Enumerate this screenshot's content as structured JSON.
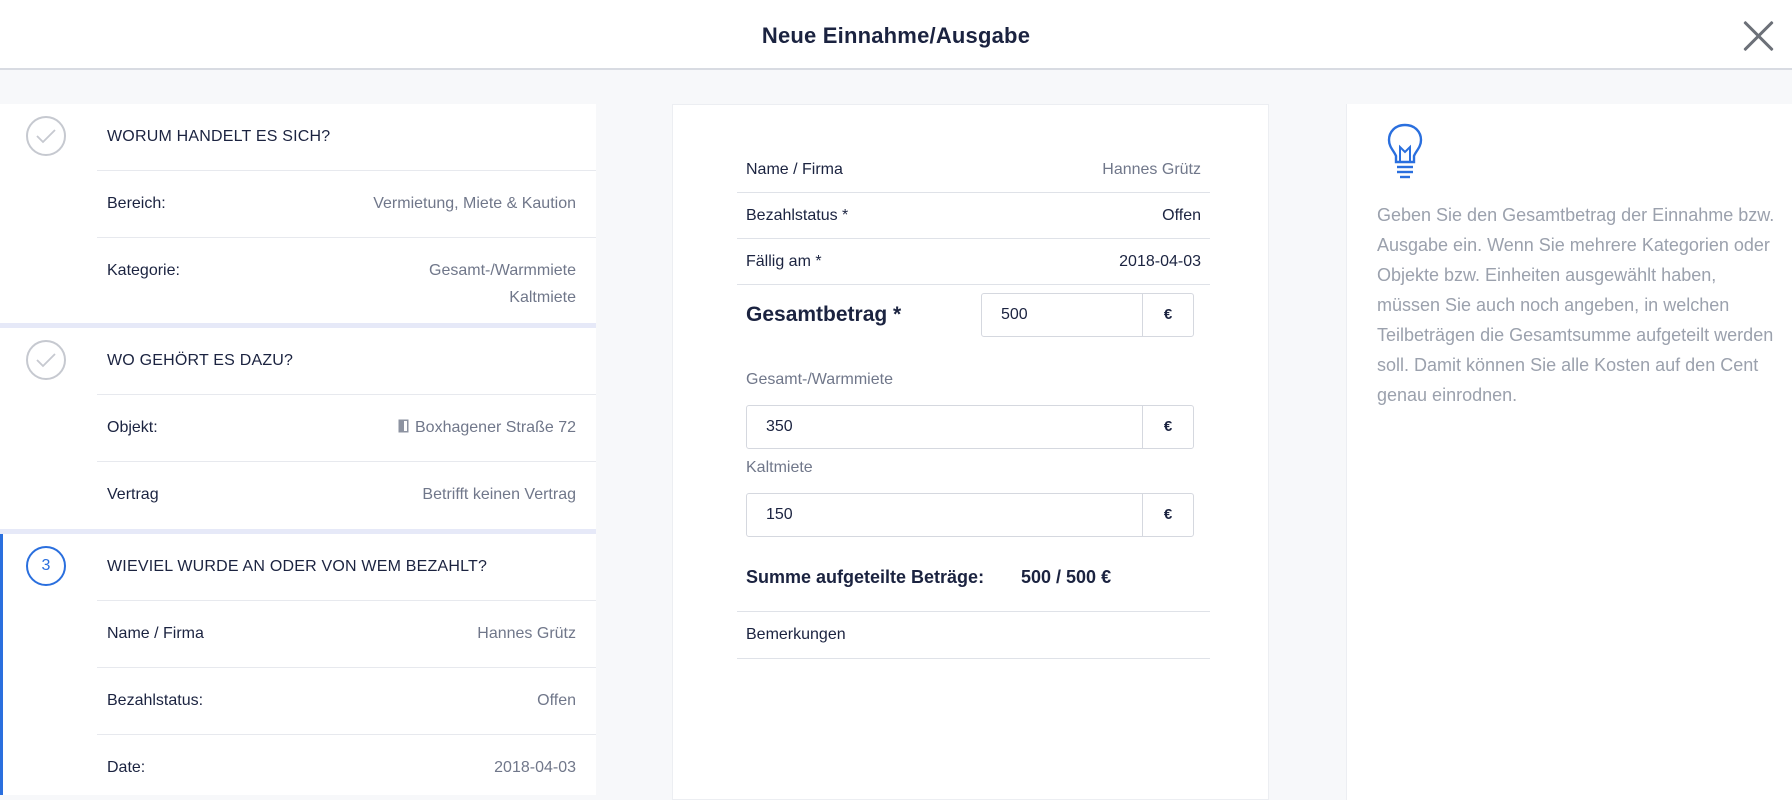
{
  "header": {
    "title": "Neue Einnahme/Ausgabe",
    "close_icon": "close-icon"
  },
  "steps": [
    {
      "title": "WORUM HANDELT ES SICH?",
      "status": "done",
      "rows": [
        {
          "label": "Bereich:",
          "value": "Vermietung, Miete & Kaution"
        },
        {
          "label": "Kategorie:",
          "value_lines": [
            "Gesamt-/Warmmiete",
            "Kaltmiete"
          ]
        }
      ]
    },
    {
      "title": "WO GEHÖRT ES DAZU?",
      "status": "done",
      "rows": [
        {
          "label": "Objekt:",
          "value": "Boxhagener Straße 72",
          "icon": "building-icon"
        },
        {
          "label": "Vertrag",
          "value": "Betrifft keinen Vertrag"
        }
      ]
    },
    {
      "number": "3",
      "title": "WIEVIEL WURDE AN ODER VON WEM BEZAHLT?",
      "status": "active",
      "rows": [
        {
          "label": "Name / Firma",
          "value": "Hannes Grütz"
        },
        {
          "label": "Bezahlstatus:",
          "value": "Offen"
        },
        {
          "label": "Date:",
          "value": "2018-04-03"
        }
      ]
    }
  ],
  "form": {
    "name": {
      "label": "Name / Firma",
      "value": "Hannes Grütz"
    },
    "status": {
      "label": "Bezahlstatus *",
      "value": "Offen"
    },
    "due": {
      "label": "Fällig am *",
      "value": "2018-04-03"
    },
    "total": {
      "label": "Gesamtbetrag *",
      "value": "500",
      "unit": "€"
    },
    "splits": [
      {
        "label": "Gesamt-/Warmmiete",
        "value": "350",
        "unit": "€"
      },
      {
        "label": "Kaltmiete",
        "value": "150",
        "unit": "€"
      }
    ],
    "sum_label": "Summe aufgeteilte Beträge:",
    "sum_value": "500 / 500 €",
    "remarks_label": "Bemerkungen"
  },
  "hint": {
    "icon": "lightbulb-icon",
    "text": "Geben Sie den Gesamtbetrag der Einnahme bzw. Ausgabe ein. Wenn Sie mehrere Kategorien oder Objekte bzw. Einheiten ausgewählt haben, müssen Sie auch noch angeben, in welchen Teilbeträgen die Gesamtsumme aufgeteilt werden soll. Damit können Sie alle Kosten auf den Cent genau einrodnen."
  },
  "colors": {
    "accent": "#2a6fde",
    "text": "#1b2340",
    "muted": "#70778a",
    "hint": "#9ba1ad"
  }
}
